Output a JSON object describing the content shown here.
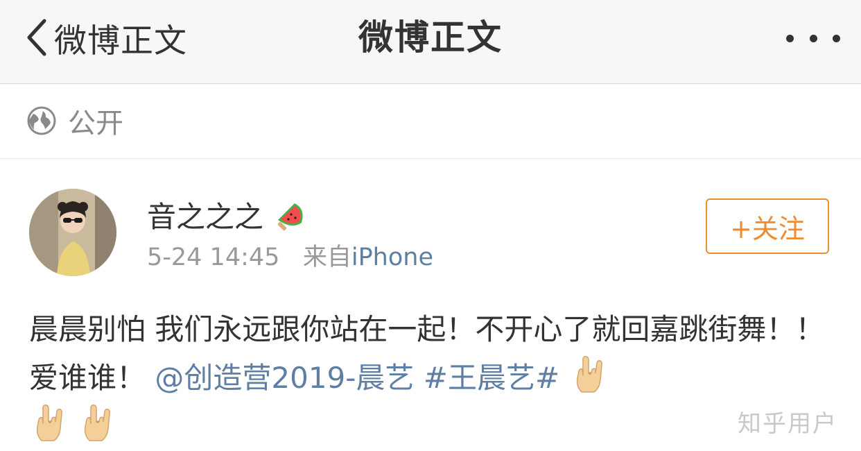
{
  "navbar": {
    "back_label": "微博正文",
    "title": "微博正文",
    "more_icon": "more-dots-icon"
  },
  "visibility": {
    "icon": "globe-icon",
    "label": "公开"
  },
  "post": {
    "username": "音之之之",
    "badge_icon": "watermelon-popsicle-icon",
    "time": "5-24 14:45",
    "source_prefix": "来自",
    "source": "iPhone",
    "follow_label": "+关注",
    "text_part1": "晨晨别怕 我们永远跟你站在一起！不开心了就回嘉跳街舞！！爱谁谁！",
    "mention": "@创造营2019-晨艺",
    "hashtag": "#王晨艺#",
    "emoji_icon": "rock-hand-icon",
    "emoji_count": 3
  },
  "watermark": "知乎用户",
  "colors": {
    "navbar_bg": "#f7f7f7",
    "text": "#333333",
    "meta_gray": "#999999",
    "link_blue": "#5e7fa3",
    "follow_orange": "#ee8c2f"
  }
}
